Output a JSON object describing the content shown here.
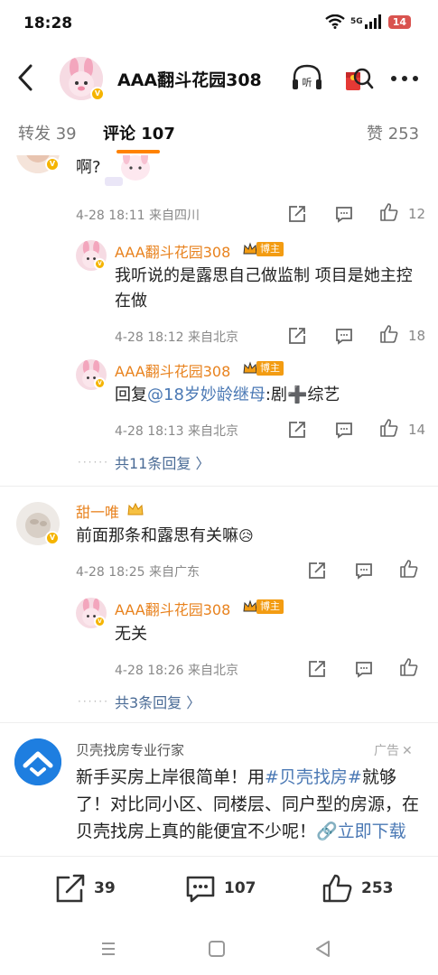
{
  "status": {
    "time": "18:28",
    "network": "5G",
    "battery": "14"
  },
  "header": {
    "title": "AAA翻斗花园308"
  },
  "tabs": [
    {
      "label": "转发 39"
    },
    {
      "label": "评论 107"
    },
    {
      "label": "赞 253"
    }
  ],
  "comments": {
    "c1": {
      "text": "啊?",
      "meta": "4-28 18:11 来自四川",
      "likes": "12"
    },
    "r1": {
      "user": "AAA翻斗花园308",
      "badge": "博主",
      "text": "我听说的是露思自己做监制 项目是她主控在做",
      "meta": "4-28 18:12 来自北京",
      "likes": "18"
    },
    "r2": {
      "user": "AAA翻斗花园308",
      "badge": "博主",
      "prefix": "回复",
      "mention": "@18岁妙龄继母",
      "text": ":剧➕综艺",
      "meta": "4-28 18:13 来自北京",
      "likes": "14"
    },
    "more1": "共11条回复 〉",
    "c2": {
      "user": "甜一唯",
      "text": "前面那条和露思有关嘛",
      "emoji": "😥",
      "meta": "4-28 18:25 来自广东"
    },
    "r3": {
      "user": "AAA翻斗花园308",
      "badge": "博主",
      "text": "无关",
      "meta": "4-28 18:26 来自北京"
    },
    "more2": "共3条回复 〉"
  },
  "ad": {
    "name": "贝壳找房专业行家",
    "tag": "广告",
    "text_a": "新手买房上岸很简单！用",
    "hashtag": "#贝壳找房#",
    "text_b": "就够了！对比同小区、同楼层、同户型的房源，在贝壳找房上真的能便宜不少呢！",
    "cta": "🔗立即下载"
  },
  "bottom_bar": {
    "reposts": "39",
    "comments": "107",
    "likes": "253"
  }
}
